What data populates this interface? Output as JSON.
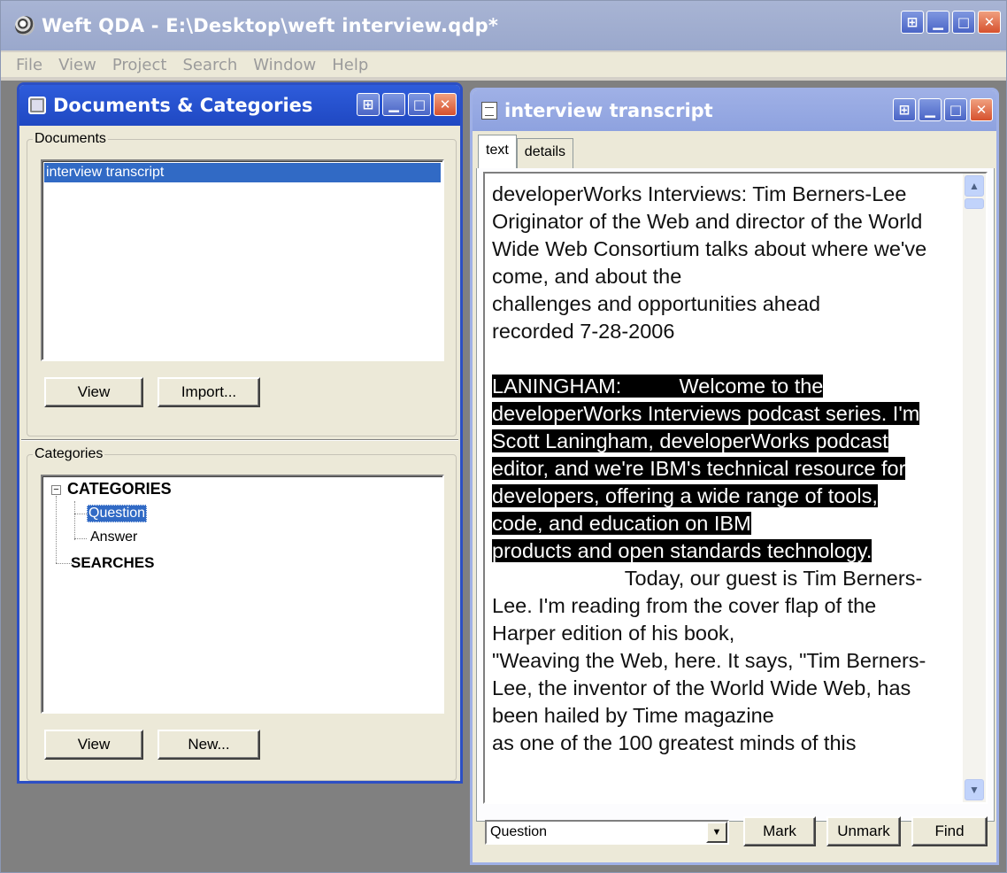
{
  "app": {
    "title": "Weft QDA - E:\\Desktop\\weft interview.qdp*"
  },
  "menu": [
    "File",
    "View",
    "Project",
    "Search",
    "Window",
    "Help"
  ],
  "docs_window": {
    "title": "Documents & Categories",
    "documents_legend": "Documents",
    "documents": [
      "interview transcript"
    ],
    "view_label": "View",
    "import_label": "Import...",
    "categories_legend": "Categories",
    "tree": {
      "root": "CATEGORIES",
      "children": [
        "Question",
        "Answer"
      ],
      "searches": "SEARCHES",
      "collapse_symbol": "−"
    },
    "view2_label": "View",
    "new_label": "New..."
  },
  "transcript_window": {
    "title": "interview transcript",
    "tabs": [
      "text",
      "details"
    ],
    "text": {
      "header": [
        "developerWorks Interviews: Tim Berners-Lee",
        "Originator of the Web and director of the World",
        "Wide Web Consortium talks about where we've",
        "come, and about the",
        "challenges and opportunities ahead",
        "recorded 7-28-2006"
      ],
      "highlighted": [
        "LANINGHAM:          Welcome to the",
        "developerWorks Interviews podcast series.  I'm",
        "Scott Laningham, developerWorks podcast",
        "editor, and we're IBM's technical resource for",
        "developers, offering a wide range of tools,",
        "code, and education on IBM",
        "products and open standards technology."
      ],
      "after": [
        "                       Today, our guest is Tim Berners-",
        "Lee. I'm reading from the cover flap of the",
        "Harper edition of his book,",
        "\"Weaving the Web, here. It says, \"Tim Berners-",
        "Lee, the inventor of the World Wide Web, has",
        "been hailed by Time magazine",
        "as one of the 100 greatest minds of this"
      ]
    },
    "category_combo": "Question",
    "mark_label": "Mark",
    "unmark_label": "Unmark",
    "find_label": "Find"
  },
  "colors": {
    "active_title": "#2e5cdb",
    "selection": "#316ac5",
    "highlight": "#000000"
  },
  "icons": {
    "app": "weft-logo-icon",
    "pin": "pin-icon",
    "minimize": "minimize-icon",
    "maximize": "maximize-icon",
    "close": "close-icon"
  }
}
